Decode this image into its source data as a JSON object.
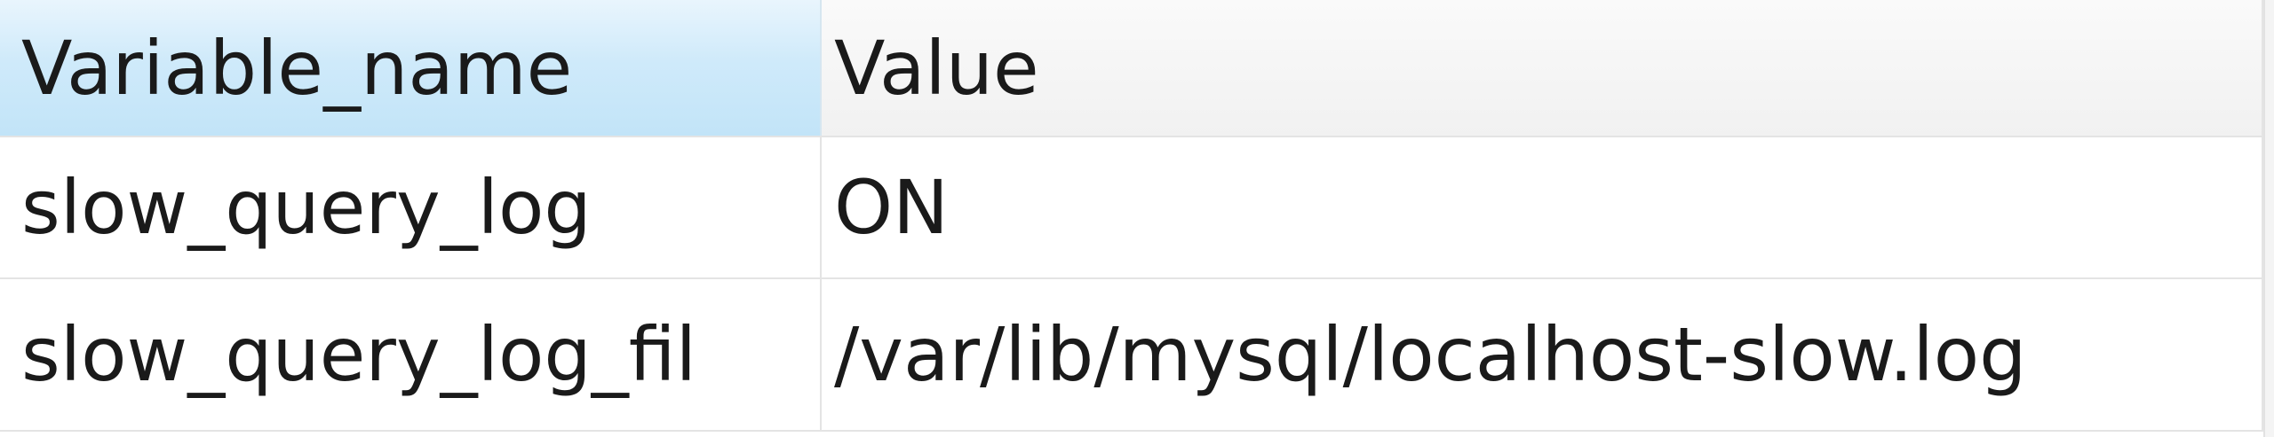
{
  "table": {
    "columns": [
      "Variable_name",
      "Value"
    ],
    "rows": [
      [
        "slow_query_log",
        "ON"
      ],
      [
        "slow_query_log_fil",
        "/var/lib/mysql/localhost-slow.log"
      ]
    ]
  },
  "colors": {
    "selected_header_bg": "#c2e4f8",
    "header_bg": "#f1f1f1",
    "gridline": "#e4e4e4",
    "text": "#1a1a1a"
  }
}
